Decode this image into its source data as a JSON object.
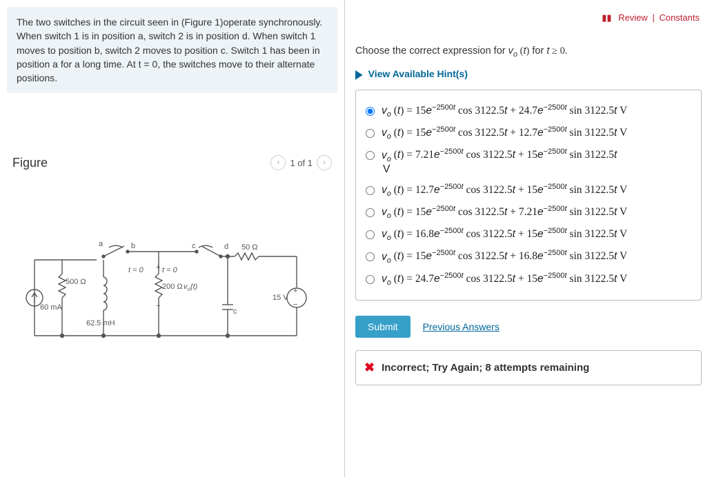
{
  "topLinks": {
    "review": "Review",
    "constants": "Constants"
  },
  "problem": "The two switches in the circuit seen in (Figure 1)operate synchronously. When switch 1 is in position a, switch 2 is in position d. When switch 1 moves to position b, switch 2 moves to position c. Switch 1 has been in position a for a long time. At t = 0, the switches move to their alternate positions.",
  "figure": {
    "title": "Figure",
    "pager": "1 of 1"
  },
  "circuit": {
    "r1": "500 Ω",
    "isrc": "60 mA",
    "l": "62.5 mH",
    "r2": "200 Ω",
    "vo": "v_o(t)",
    "r3": "50 Ω",
    "vsrc": "15 V",
    "c": "c",
    "t0a": "t = 0",
    "t0b": "t = 0",
    "a": "a",
    "b": "b",
    "d": "d"
  },
  "prompt": {
    "pre": "Choose the correct expression for ",
    "mid": " for ",
    "var": "v_o (t)",
    "cond": "t ≥ 0."
  },
  "hints": "View Available Hint(s)",
  "options": [
    "v_o (t) = 15e^{−2500t} cos 3122.5t + 24.7e^{−2500t} sin 3122.5t V",
    "v_o (t) = 15e^{−2500t} cos 3122.5t + 12.7e^{−2500t} sin 3122.5t V",
    "v_o (t) = 7.21e^{−2500t} cos 3122.5t + 15e^{−2500t} sin 3122.5t V",
    "v_o (t) = 12.7e^{−2500t} cos 3122.5t + 15e^{−2500t} sin 3122.5t V",
    "v_o (t) = 15e^{−2500t} cos 3122.5t + 7.21e^{−2500t} sin 3122.5t V",
    "v_o (t) = 16.8e^{−2500t} cos 3122.5t + 15e^{−2500t} sin 3122.5t V",
    "v_o (t) = 15e^{−2500t} cos 3122.5t + 16.8e^{−2500t} sin 3122.5t V",
    "v_o (t) = 24.7e^{−2500t} cos 3122.5t + 15e^{−2500t} sin 3122.5t V"
  ],
  "selected": 0,
  "coeffs": [
    {
      "a": "15",
      "b": "24.7",
      "unit": " V",
      "wrap": false
    },
    {
      "a": "15",
      "b": "12.7",
      "unit": " V",
      "wrap": false
    },
    {
      "a": "7.21",
      "b": "15",
      "unit": "",
      "wrap": true
    },
    {
      "a": "12.7",
      "b": "15",
      "unit": " V",
      "wrap": false
    },
    {
      "a": "15",
      "b": "7.21",
      "unit": " V",
      "wrap": false
    },
    {
      "a": "16.8",
      "b": "15",
      "unit": " V",
      "wrap": false
    },
    {
      "a": "15",
      "b": "16.8",
      "unit": " V",
      "wrap": false
    },
    {
      "a": "24.7",
      "b": "15",
      "unit": " V",
      "wrap": false
    }
  ],
  "actions": {
    "submit": "Submit",
    "prev": "Previous Answers"
  },
  "feedback": "Incorrect; Try Again; 8 attempts remaining"
}
